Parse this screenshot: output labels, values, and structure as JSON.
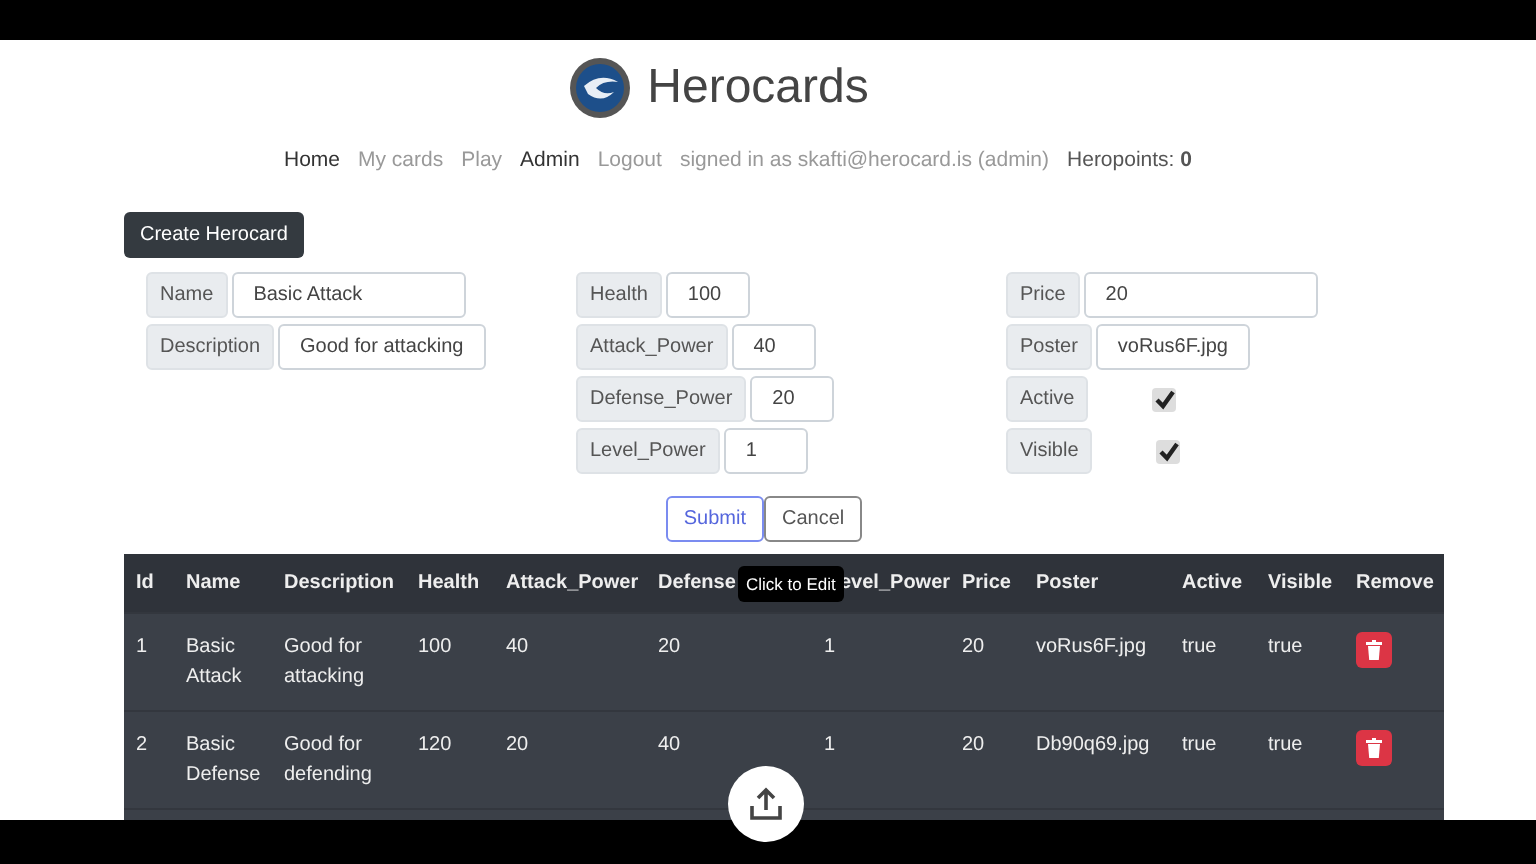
{
  "header": {
    "title": "Herocards"
  },
  "nav": [
    {
      "label": "Home",
      "strong": true
    },
    {
      "label": "My cards",
      "strong": false
    },
    {
      "label": "Play",
      "strong": false
    },
    {
      "label": "Admin",
      "strong": true
    },
    {
      "label": "Logout",
      "strong": false
    }
  ],
  "signed_in": "signed in as skafti@herocard.is (admin)",
  "heropoints": "Heropoints: **0**",
  "create_button": "Create Herocard",
  "form_columns": [
    [
      {
        "label": "Name",
        "kind": "text",
        "value": "Basic Attack"
      },
      {
        "label": "Description",
        "kind": "text",
        "value": "Good for attacking"
      }
    ],
    [
      {
        "label": "Health",
        "kind": "text",
        "value": "100"
      },
      {
        "label": "Attack_Power",
        "kind": "text",
        "value": "40"
      },
      {
        "label": "Defense_Power",
        "kind": "text",
        "value": "20"
      },
      {
        "label": "Level_Power",
        "kind": "text",
        "value": "1"
      }
    ],
    [
      {
        "label": "Price",
        "kind": "text",
        "value": "20"
      },
      {
        "label": "Poster",
        "kind": "text",
        "value": "voRus6F.jpg"
      },
      {
        "label": "Active",
        "kind": "checkbox",
        "checked": true
      },
      {
        "label": "Visible",
        "kind": "checkbox",
        "checked": true
      }
    ]
  ],
  "form_buttons": [
    {
      "label": "Submit",
      "kind": "primary"
    },
    {
      "label": "Cancel",
      "kind": "secondary"
    }
  ],
  "table": {
    "columns": [
      "Id",
      "Name",
      "Description",
      "Health",
      "Attack_Power",
      "Defense",
      "evel_Power",
      "Price",
      "Poster",
      "Active",
      "Visible",
      "Remove"
    ],
    "rows": [
      {
        "cells": [
          "1",
          "Basic Attack",
          "Good for attacking",
          "100",
          "40",
          "20",
          "1",
          "20",
          "voRus6F.jpg",
          "true",
          "true"
        ]
      },
      {
        "cells": [
          "2",
          "Basic Defense",
          "Good for defending",
          "120",
          "20",
          "40",
          "1",
          "20",
          "Db90q69.jpg",
          "true",
          "true"
        ]
      }
    ]
  },
  "tooltip": "Click to Edit"
}
